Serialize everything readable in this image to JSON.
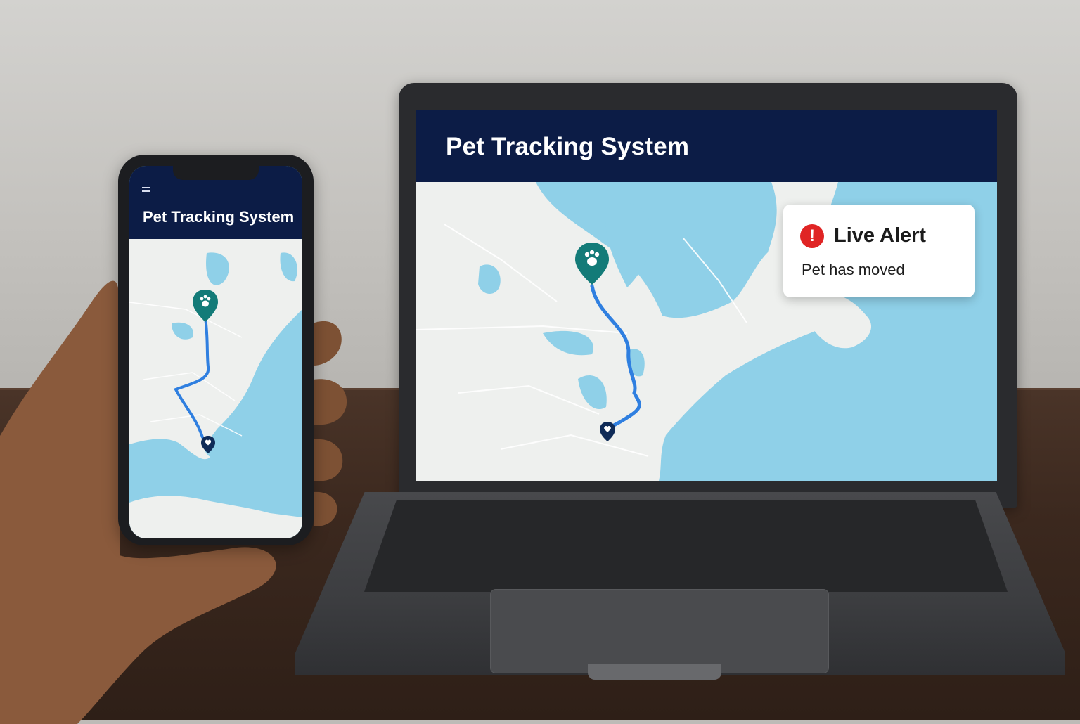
{
  "laptop": {
    "app_title": "Pet Tracking System",
    "alert": {
      "icon": "alert-circle-icon",
      "title": "Live Alert",
      "message": "Pet has moved"
    },
    "map": {
      "start_marker_icon": "paw-icon",
      "end_marker_icon": "heart-pin-icon"
    }
  },
  "phone": {
    "app_title": "Pet Tracking System",
    "menu_icon": "hamburger-menu-icon",
    "map": {
      "start_marker_icon": "paw-icon",
      "end_marker_icon": "heart-pin-icon"
    }
  },
  "colors": {
    "header": "#0c1c46",
    "water": "#8fd0e8",
    "land": "#eef0ee",
    "route": "#2f7fe0",
    "marker": "#137b78",
    "alert_red": "#e02424"
  }
}
